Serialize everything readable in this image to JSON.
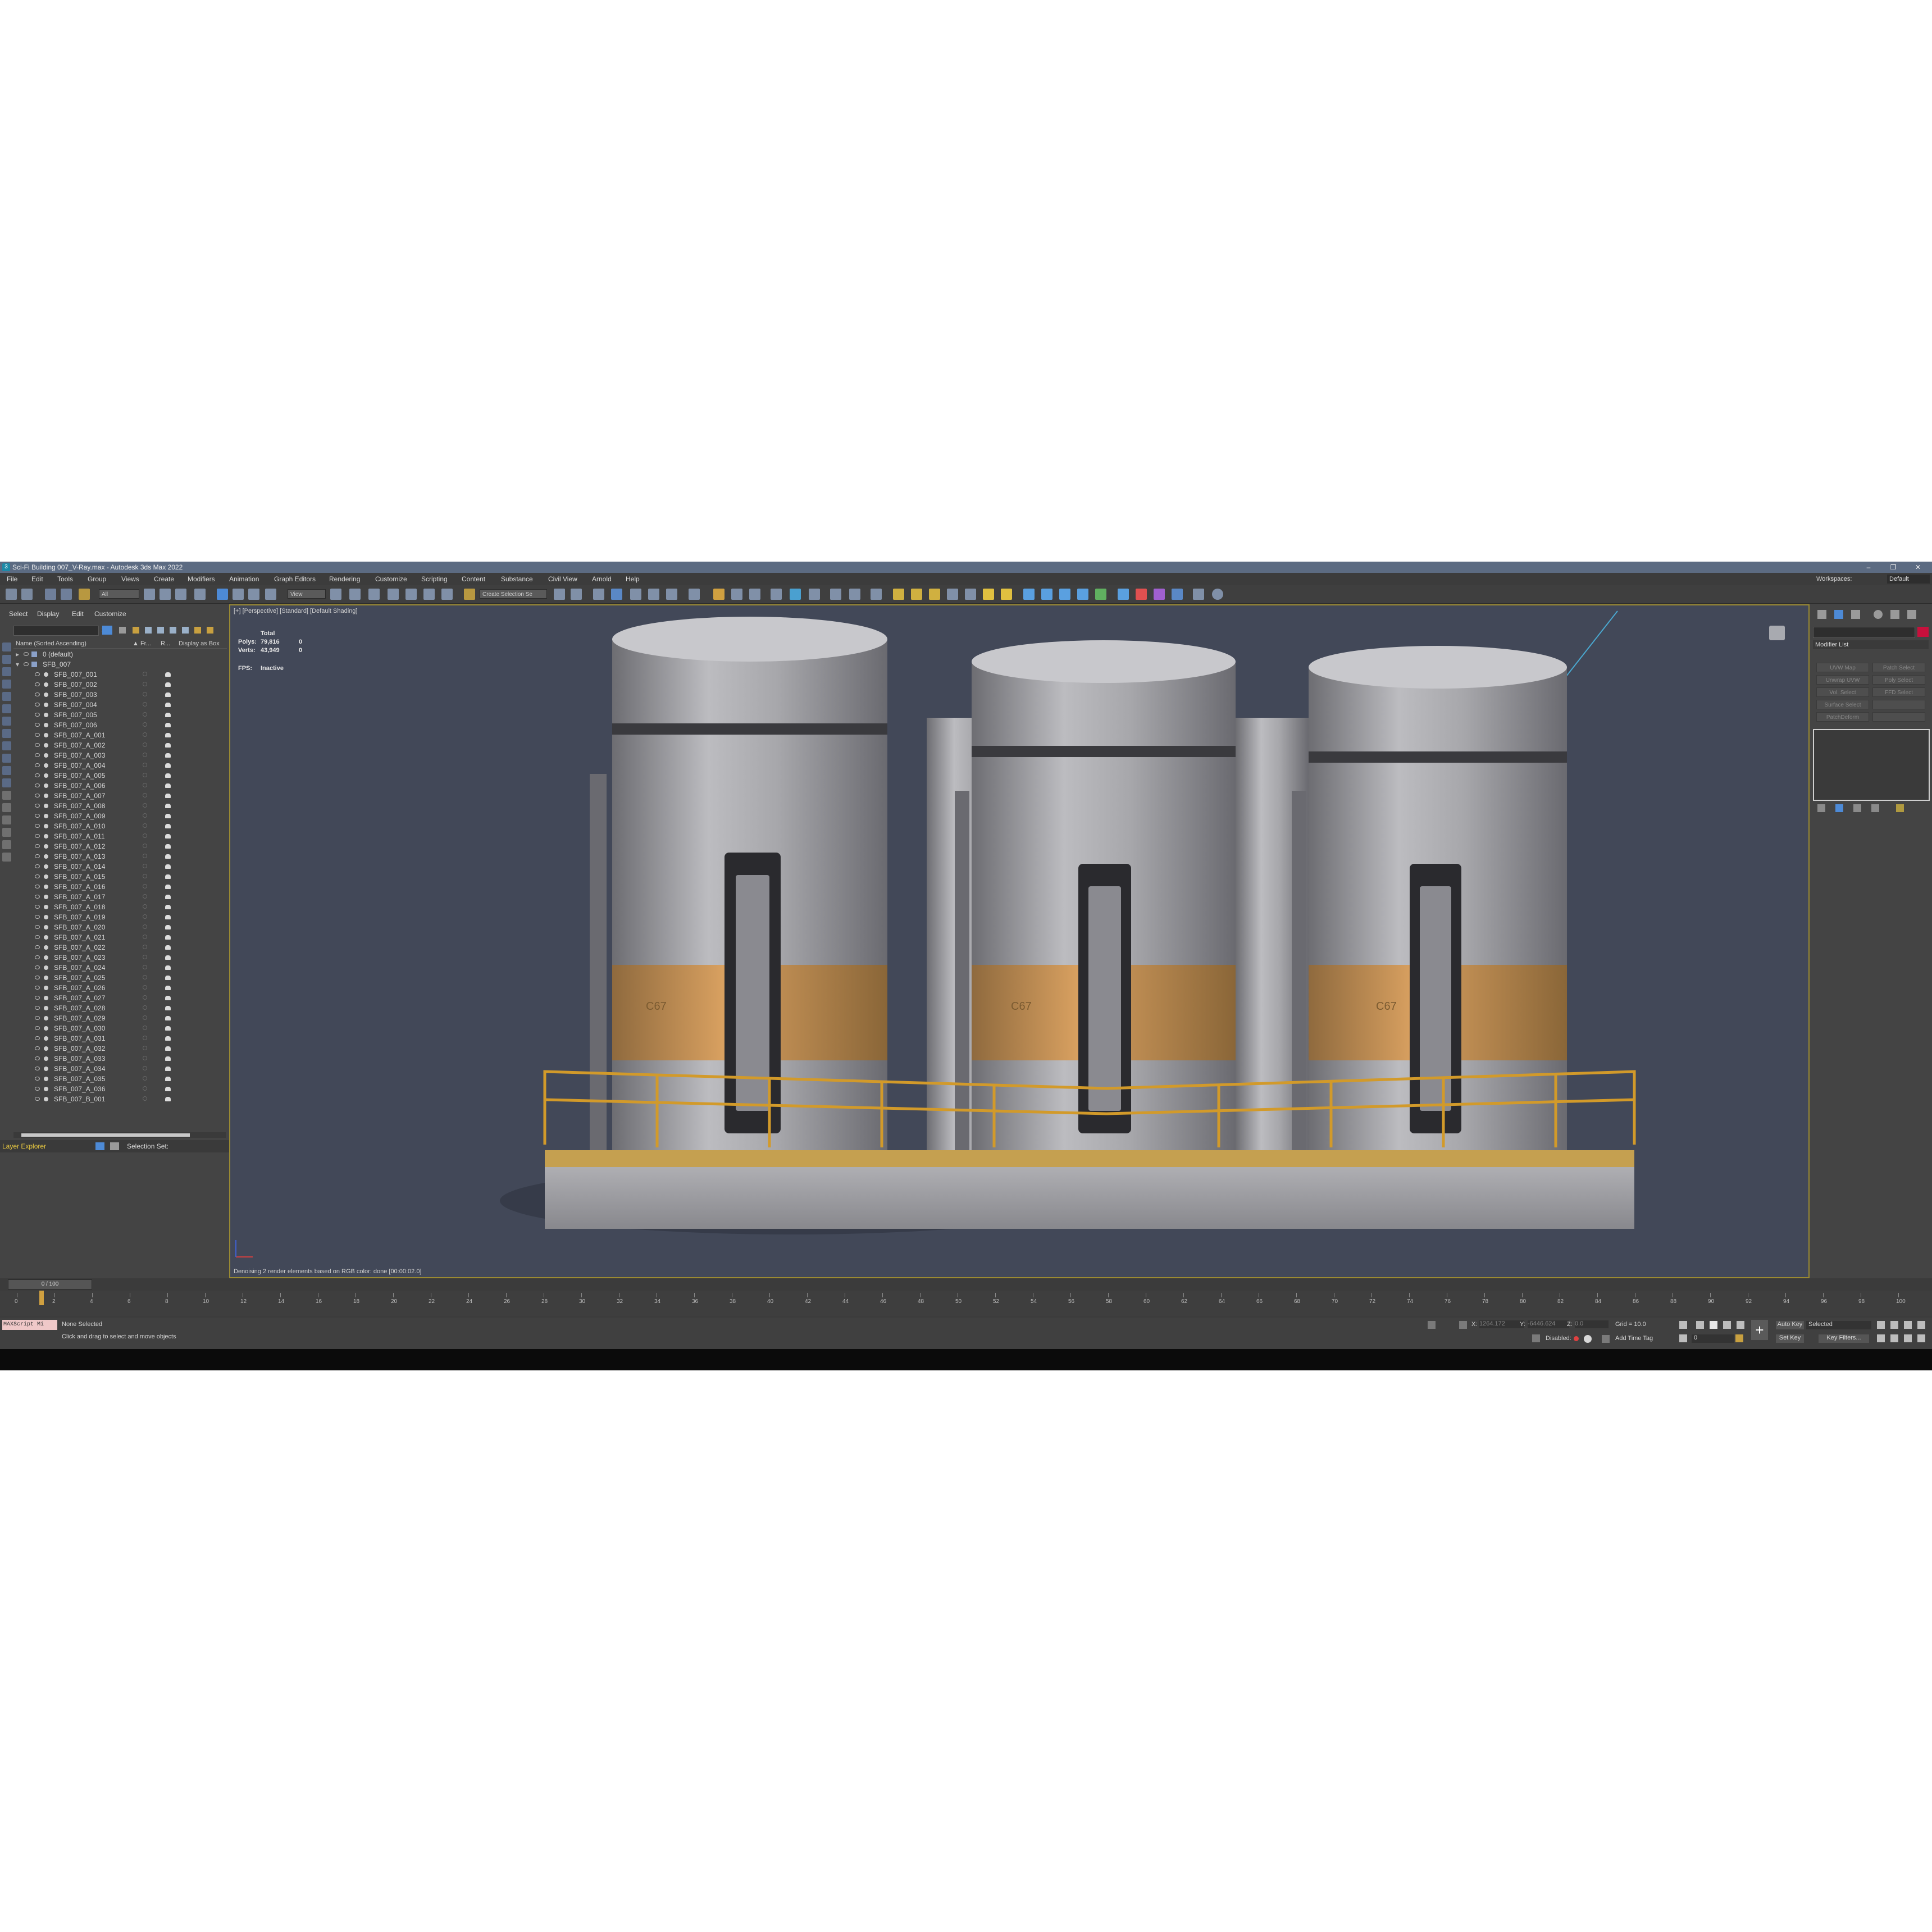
{
  "window": {
    "title": "Sci-Fi Building 007_V-Ray.max - Autodesk 3ds Max 2022",
    "app_icon": "3"
  },
  "window_controls": {
    "minimize": "–",
    "maximize": "❐",
    "close": "✕"
  },
  "menu": [
    "File",
    "Edit",
    "Tools",
    "Group",
    "Views",
    "Create",
    "Modifiers",
    "Animation",
    "Graph Editors",
    "Rendering",
    "Customize",
    "Scripting",
    "Content",
    "Substance",
    "Civil View",
    "Arnold",
    "Help"
  ],
  "workspaces": {
    "label": "Workspaces:",
    "value": "Default"
  },
  "toolbar": {
    "filter_value": "All",
    "refcoord_value": "View",
    "selection_set_value": "Create Selection Se"
  },
  "scene_explorer": {
    "tabs": [
      "Select",
      "Display",
      "Edit",
      "Customize"
    ],
    "columns": {
      "name": "Name (Sorted Ascending)",
      "frozen": "▲ Fr...",
      "render": "R...",
      "display_as_box": "Display as Box"
    },
    "layers": [
      "0 (default)",
      "SFB_007"
    ],
    "objects": [
      "SFB_007_001",
      "SFB_007_002",
      "SFB_007_003",
      "SFB_007_004",
      "SFB_007_005",
      "SFB_007_006",
      "SFB_007_A_001",
      "SFB_007_A_002",
      "SFB_007_A_003",
      "SFB_007_A_004",
      "SFB_007_A_005",
      "SFB_007_A_006",
      "SFB_007_A_007",
      "SFB_007_A_008",
      "SFB_007_A_009",
      "SFB_007_A_010",
      "SFB_007_A_011",
      "SFB_007_A_012",
      "SFB_007_A_013",
      "SFB_007_A_014",
      "SFB_007_A_015",
      "SFB_007_A_016",
      "SFB_007_A_017",
      "SFB_007_A_018",
      "SFB_007_A_019",
      "SFB_007_A_020",
      "SFB_007_A_021",
      "SFB_007_A_022",
      "SFB_007_A_023",
      "SFB_007_A_024",
      "SFB_007_A_025",
      "SFB_007_A_026",
      "SFB_007_A_027",
      "SFB_007_A_028",
      "SFB_007_A_029",
      "SFB_007_A_030",
      "SFB_007_A_031",
      "SFB_007_A_032",
      "SFB_007_A_033",
      "SFB_007_A_034",
      "SFB_007_A_035",
      "SFB_007_A_036",
      "SFB_007_B_001"
    ],
    "footer_label": "Layer Explorer",
    "selection_set_label": "Selection Set:"
  },
  "viewport": {
    "label": "[+] [Perspective] [Standard] [Default Shading]",
    "stats": {
      "total": "Total",
      "polys_label": "Polys:",
      "polys": "79,816",
      "polys_sel": "0",
      "verts_label": "Verts:",
      "verts": "43,949",
      "verts_sel": "0",
      "fps_label": "FPS:",
      "fps": "Inactive"
    },
    "denoise_msg": "Denoising 2 render elements based on RGB color: done [00:00:02.0]",
    "tank_marking": "C67"
  },
  "command_panel": {
    "modifier_list": "Modifier List",
    "buttons": [
      "UVW Map",
      "Patch Select",
      "Unwrap UVW",
      "Poly Select",
      "Vol. Select",
      "FFD Select",
      "Surface Select",
      "",
      "PatchDeform",
      ""
    ],
    "color_swatch": "#c8103c"
  },
  "timeline": {
    "frame_display": "0 / 100",
    "ticks": [
      "0",
      "2",
      "4",
      "6",
      "8",
      "10",
      "12",
      "14",
      "16",
      "18",
      "20",
      "22",
      "24",
      "26",
      "28",
      "30",
      "32",
      "34",
      "36",
      "38",
      "40",
      "42",
      "44",
      "46",
      "48",
      "50",
      "52",
      "54",
      "56",
      "58",
      "60",
      "62",
      "64",
      "66",
      "68",
      "70",
      "72",
      "74",
      "76",
      "78",
      "80",
      "82",
      "84",
      "86",
      "88",
      "90",
      "92",
      "94",
      "96",
      "98",
      "100"
    ]
  },
  "status": {
    "maxscript_label": "MAXScript Mi",
    "selection": "None Selected",
    "prompt": "Click and drag to select and move objects",
    "x_label": "X:",
    "x": "1264.172",
    "y_label": "Y:",
    "y": "-6446.624",
    "z_label": "Z:",
    "z": "0.0",
    "grid": "Grid = 10.0",
    "disabled_label": "Disabled:",
    "add_time_tag": "Add Time Tag",
    "auto_key": "Auto Key",
    "set_key": "Set Key",
    "selected": "Selected",
    "key_filters": "Key Filters...",
    "frame": "0"
  },
  "colors": {
    "accent": "#5b9bd5",
    "titlebar": "#5c6b82",
    "viewport_bg": "#424858",
    "viewport_border": "#9a8a32",
    "railing": "#d29a2a"
  }
}
